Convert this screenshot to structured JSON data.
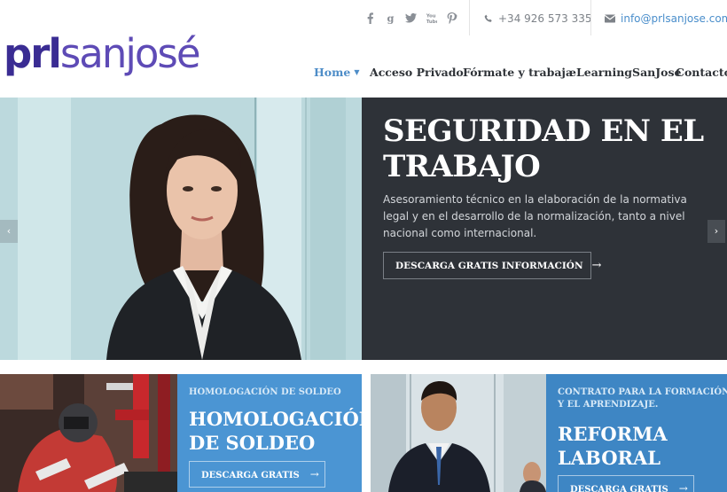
{
  "header": {
    "social": [
      {
        "name": "facebook-icon",
        "glyph": "f"
      },
      {
        "name": "google-plus-icon",
        "glyph": "g"
      },
      {
        "name": "twitter-icon",
        "glyph": ""
      },
      {
        "name": "youtube-icon",
        "glyph": "You Tube"
      },
      {
        "name": "pinterest-icon",
        "glyph": "p"
      }
    ],
    "phone": "+34 926 573 335",
    "email": "info@prlsanjose.com",
    "logo_part1": "prl",
    "logo_part2": "sanjosé"
  },
  "nav": {
    "items": [
      {
        "label": "Home",
        "active": true
      },
      {
        "label": "Acceso Privado"
      },
      {
        "label": "Fórmate y trabaja"
      },
      {
        "label": "eLearningSanJose"
      },
      {
        "label": "Contacto"
      }
    ]
  },
  "hero": {
    "title": "SEGURIDAD EN EL TRABAJO",
    "text": "Asesoramiento técnico en la elaboración de la normativa legal y en el desarrollo de la normalización, tanto a nivel nacional como internacional.",
    "button_label": "DESCARGA GRATIS INFORMACIÓN",
    "button_arrow": "→",
    "prev_arrow": "‹",
    "next_arrow": "›"
  },
  "promos": [
    {
      "kicker": "HOMOLOGACIÓN DE SOLDEO",
      "title": "HOMOLOGACIÓN DE SOLDEO",
      "button_label": "DESCARGA GRATIS",
      "button_arrow": "→"
    },
    {
      "kicker": "CONTRATO PARA LA FORMACIÓN Y EL APRENDIZAJE.",
      "title": "REFORMA LABORAL",
      "button_label": "DESCARGA GRATIS",
      "button_arrow": "→"
    }
  ],
  "colors": {
    "brand_dark": "#3a2c93",
    "brand_light": "#5e4bb6",
    "accent_blue": "#4b95d3",
    "hero_panel": "#2e3238"
  }
}
